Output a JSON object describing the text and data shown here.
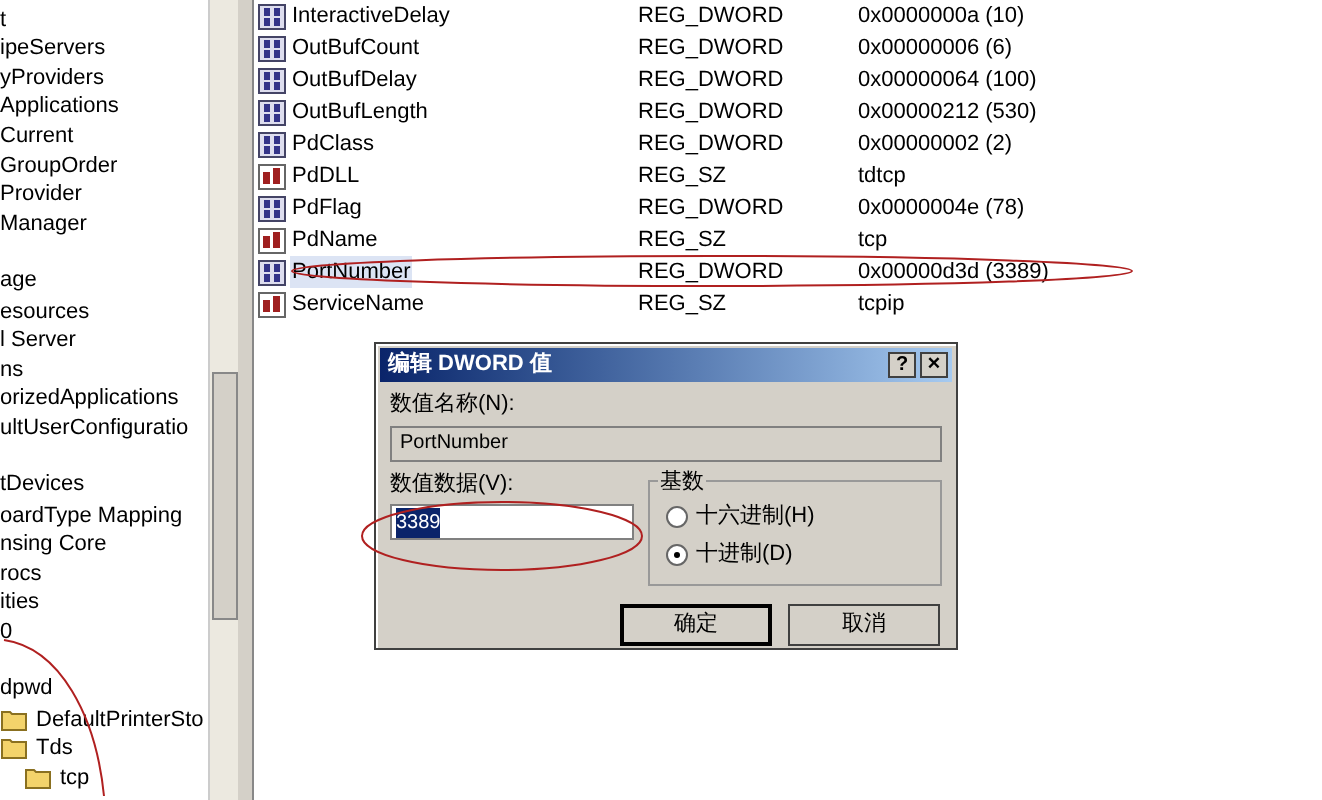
{
  "tree": {
    "items": [
      {
        "label": "t"
      },
      {
        "label": "ipeServers"
      },
      {
        "label": "yProviders"
      },
      {
        "label": "Applications"
      },
      {
        "label": "Current"
      },
      {
        "label": "GroupOrder"
      },
      {
        "label": "Provider"
      },
      {
        "label": " Manager"
      },
      {
        "label": "age",
        "gap_before": true
      },
      {
        "label": "esources"
      },
      {
        "label": "l Server"
      },
      {
        "label": "ns"
      },
      {
        "label": "orizedApplications"
      },
      {
        "label": "ultUserConfiguratio"
      },
      {
        "label": "tDevices",
        "gap_before": true
      },
      {
        "label": "oardType Mapping"
      },
      {
        "label": "nsing Core"
      },
      {
        "label": "rocs"
      },
      {
        "label": "ities"
      },
      {
        "label": "0"
      },
      {
        "label": "dpwd",
        "gap_before": true,
        "children": [
          {
            "label": "DefaultPrinterSto"
          },
          {
            "label": "Tds",
            "children": [
              {
                "label": "tcp"
              }
            ]
          }
        ]
      }
    ]
  },
  "values": [
    {
      "name": "InteractiveDelay",
      "kind": "binary",
      "type": "REG_DWORD",
      "data": "0x0000000a (10)",
      "selected": false
    },
    {
      "name": "OutBufCount",
      "kind": "binary",
      "type": "REG_DWORD",
      "data": "0x00000006 (6)",
      "selected": false
    },
    {
      "name": "OutBufDelay",
      "kind": "binary",
      "type": "REG_DWORD",
      "data": "0x00000064 (100)",
      "selected": false
    },
    {
      "name": "OutBufLength",
      "kind": "binary",
      "type": "REG_DWORD",
      "data": "0x00000212 (530)",
      "selected": false
    },
    {
      "name": "PdClass",
      "kind": "binary",
      "type": "REG_DWORD",
      "data": "0x00000002 (2)",
      "selected": false
    },
    {
      "name": "PdDLL",
      "kind": "string",
      "type": "REG_SZ",
      "data": "tdtcp",
      "selected": false
    },
    {
      "name": "PdFlag",
      "kind": "binary",
      "type": "REG_DWORD",
      "data": "0x0000004e (78)",
      "selected": false
    },
    {
      "name": "PdName",
      "kind": "string",
      "type": "REG_SZ",
      "data": "tcp",
      "selected": false
    },
    {
      "name": "PortNumber",
      "kind": "binary",
      "type": "REG_DWORD",
      "data": "0x00000d3d (3389)",
      "selected": true
    },
    {
      "name": "ServiceName",
      "kind": "string",
      "type": "REG_SZ",
      "data": "tcpip",
      "selected": false
    }
  ],
  "dialog": {
    "title": "编辑 DWORD 值",
    "help": "?",
    "close": "×",
    "name_label": "数值名称(N):",
    "name_value": "PortNumber",
    "data_label": "数值数据(V):",
    "data_value": "3389",
    "base_label": "基数",
    "radios": [
      {
        "label": "十六进制(H)",
        "selected": false
      },
      {
        "label": "十进制(D)",
        "selected": true
      }
    ],
    "buttons": [
      "确定",
      "取消"
    ]
  }
}
